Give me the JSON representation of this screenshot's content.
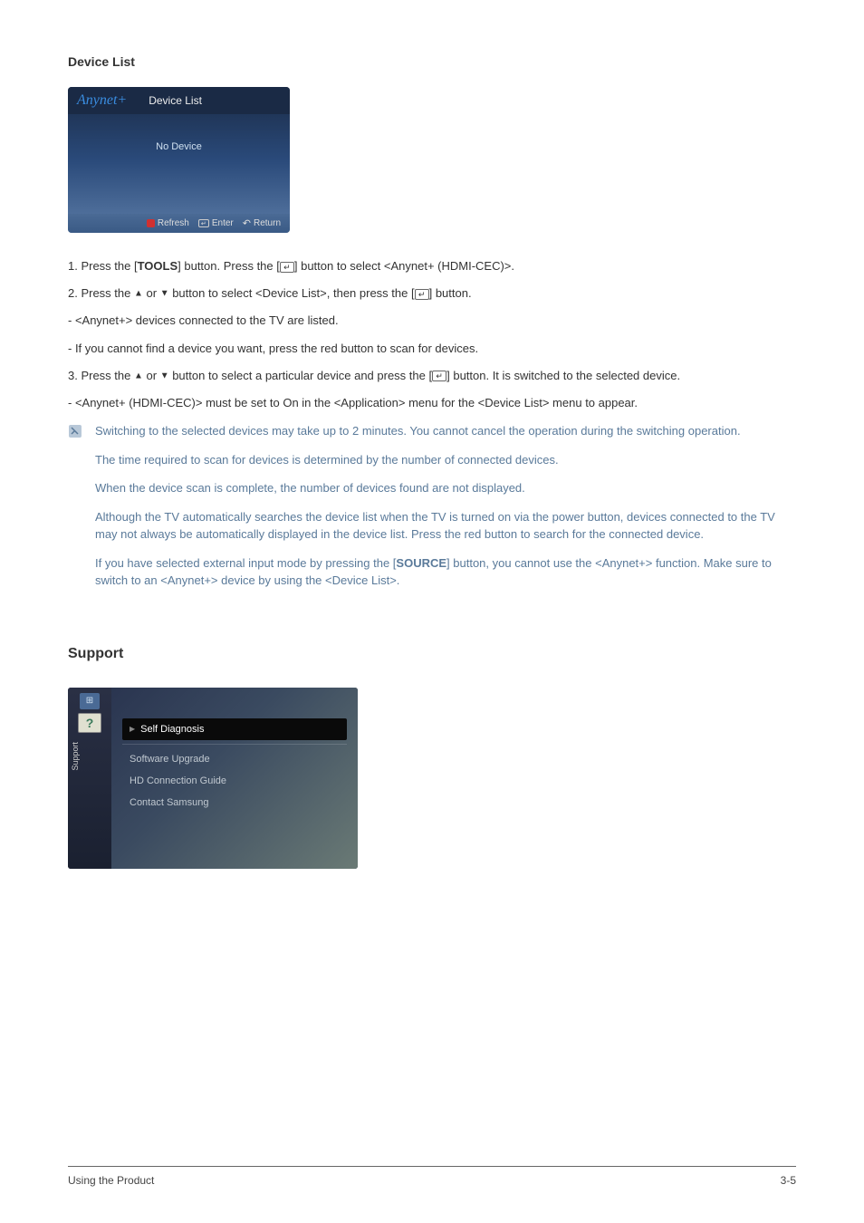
{
  "sections": {
    "device_list_title": "Device List",
    "support_title": "Support"
  },
  "device_list_panel": {
    "logo": "Anynet+",
    "title": "Device List",
    "body": "No Device",
    "footer": {
      "refresh": "Refresh",
      "enter": "Enter",
      "return": "Return"
    }
  },
  "instructions": {
    "step1_a": "1. Press the [",
    "step1_tools": "TOOLS",
    "step1_b": "] button. Press the [",
    "step1_c": "] button to select <Anynet+ (HDMI-CEC)>.",
    "step2_a": "2. Press the ",
    "step2_b": " or ",
    "step2_c": " button to select <Device List>, then press the [",
    "step2_d": "] button.",
    "bullet1": " - <Anynet+> devices connected to the TV are listed.",
    "bullet2": " - If you cannot find a device you want, press the red button to scan for devices.",
    "step3_a": "3. Press the ",
    "step3_b": " or ",
    "step3_c": " button to select a particular device and press the [",
    "step3_d": "] button. It is switched to the selected device.",
    "bullet3": " - <Anynet+ (HDMI-CEC)> must be set to On in the <Application> menu for the <Device List> menu to appear."
  },
  "notes": {
    "n1": "Switching to the selected devices may take up to 2 minutes. You cannot cancel the operation during the switching operation.",
    "n2": "The time required to scan for devices is determined by the number of connected devices.",
    "n3": "When the device scan is complete, the number of devices found are not displayed.",
    "n4": "Although the TV automatically searches the device list when the TV is turned on via the power button, devices connected to the TV may not always be automatically displayed in the device list. Press the red button to search for the connected device.",
    "n5_a": "If you have selected external input mode by pressing the [",
    "n5_source": "SOURCE",
    "n5_b": "] button, you cannot use the <Anynet+> function. Make sure to switch to an <Anynet+> device by using the <Device List>."
  },
  "support_panel": {
    "sidebar_label": "Support",
    "items": {
      "self_diag": "Self Diagnosis",
      "sw_upgrade": "Software Upgrade",
      "hd_guide": "HD Connection Guide",
      "contact": "Contact Samsung"
    }
  },
  "footer": {
    "left": "Using the Product",
    "right": "3-5"
  }
}
